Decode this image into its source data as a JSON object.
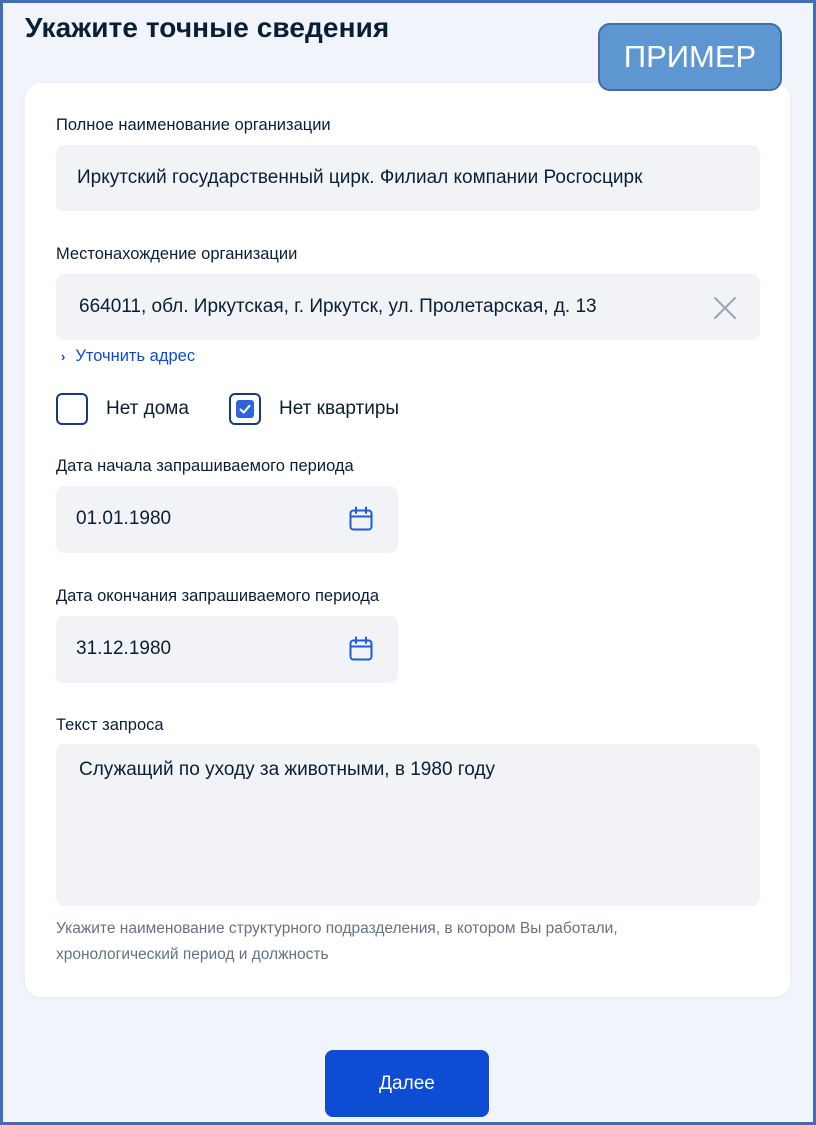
{
  "page": {
    "title": "Укажите точные сведения",
    "badge": "ПРИМЕР"
  },
  "form": {
    "org_name": {
      "label": "Полное наименование организации",
      "value": "Иркутский государственный цирк. Филиал компании Росгосцирк"
    },
    "org_location": {
      "label": "Местонахождение организации",
      "value": "664011, обл. Иркутская, г. Иркутск, ул. Пролетарская, д. 13",
      "refine_link": "Уточнить адрес"
    },
    "checkboxes": [
      {
        "label": "Нет дома",
        "checked": false
      },
      {
        "label": "Нет квартиры",
        "checked": true
      }
    ],
    "start_date": {
      "label": "Дата начала запрашиваемого периода",
      "value": "01.01.1980"
    },
    "end_date": {
      "label": "Дата окончания запрашиваемого периода",
      "value": "31.12.1980"
    },
    "request_text": {
      "label": "Текст запроса",
      "value": "Служащий по уходу за животными, в 1980 году",
      "hint_line1": "Укажите наименование структурного подразделения, в котором Вы работали,",
      "hint_line2": "хронологический период и должность"
    }
  },
  "actions": {
    "next_label": "Далее"
  },
  "colors": {
    "accent": "#0d4cd3",
    "badge_bg": "#5d96d0",
    "frame": "#3d6fb6",
    "field_bg": "#f1f3f7",
    "page_bg": "#f1f4fa"
  },
  "icons": {
    "clear": "close-icon",
    "calendar": "calendar-icon",
    "chevron": "chevron-right-icon",
    "checkmark": "checkmark-icon"
  }
}
